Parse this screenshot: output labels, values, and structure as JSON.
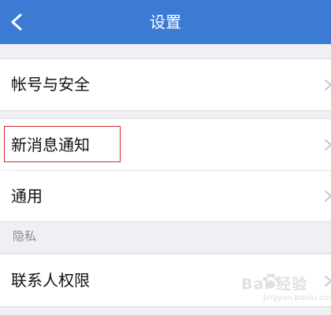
{
  "nav": {
    "title": "设置"
  },
  "settings": {
    "account_security": "帐号与安全",
    "new_message_notification": "新消息通知",
    "general": "通用",
    "privacy_header": "隐私",
    "contact_permissions": "联系人权限"
  },
  "watermark": {
    "brand": "Bai 经验",
    "url": "jingyan.baidu.com"
  },
  "colors": {
    "nav_bar": "#3b7bd4",
    "highlight": "#d8282a",
    "page_background": "#efeff4"
  },
  "icons": {
    "back": "chevron-left-icon",
    "row_arrow": "chevron-right-icon"
  }
}
